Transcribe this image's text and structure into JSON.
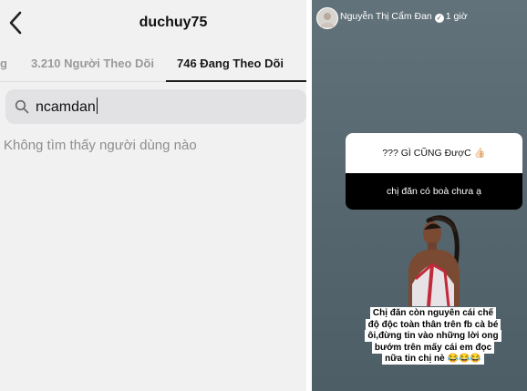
{
  "left": {
    "header": {
      "back_icon": "chevron-left-icon",
      "username": "duchuy75"
    },
    "tabs": [
      {
        "label": "g"
      },
      {
        "label": "3.210 Người Theo Dõi"
      },
      {
        "label": "746 Đang Theo Dõi"
      }
    ],
    "search": {
      "value": "ncamdan",
      "icon": "search-icon"
    },
    "empty_message": "Không tìm thấy người dùng nào"
  },
  "right": {
    "story": {
      "author": "Nguyễn Thị Cẩm Đan",
      "time": "1 giờ",
      "question_title": "??? GÌ CŨNG ĐượC",
      "question_emoji": "👍🏻",
      "answer": "chị đăn có boà chưa ạ",
      "caption": "Chị đăn còn nguyên cái chế độ độc toàn thân trên fb cà bé ôi,đừng tin vào những lời ong bướm trên mấy cái em đọc nữa tin chị nè 😂😂😂"
    }
  },
  "colors": {
    "story_bg": "#5f6f77",
    "tab_active": "#1b1b1b",
    "muted_text": "#8e8e8e"
  }
}
